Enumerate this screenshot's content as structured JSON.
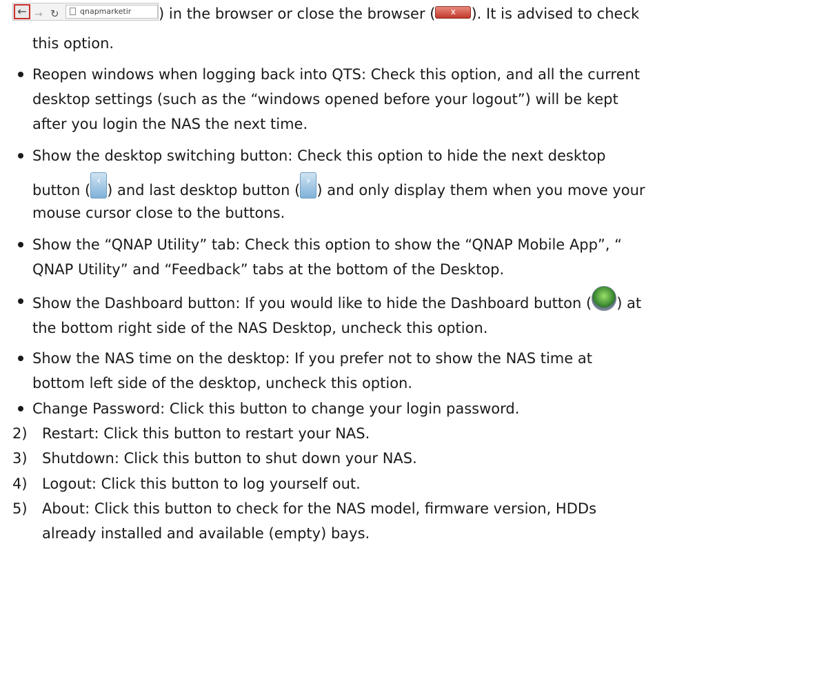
{
  "browser_url_text": "qnapmarketir",
  "close_button_glyph": "x",
  "nav_prev_glyph": "‹",
  "nav_next_glyph": "›",
  "line1_after_strip": ") in the browser or close the browser (",
  "line1_after_close": "). It is advised to check",
  "line2": "this option.",
  "bullets": [
    {
      "lines": [
        "Reopen windows when logging back into QTS: Check this option, and all the current",
        "desktop settings (such as the “windows opened before your logout”) will be kept",
        "after you login the NAS the next time."
      ]
    },
    {
      "line1": "Show the desktop switching button: Check this option to hide the next desktop",
      "line2_a": "button (",
      "line2_b": ") and last desktop button (",
      "line2_c": ") and only display them when you move your",
      "line3": "mouse cursor close to the buttons."
    },
    {
      "lines": [
        "Show the “QNAP Utility” tab: Check this option to show the “QNAP Mobile App”, “",
        "QNAP Utility” and “Feedback” tabs at the bottom of the Desktop."
      ]
    },
    {
      "line1_a": "Show the Dashboard button: If you would like to hide the Dashboard button (",
      "line1_b": ") at",
      "line2": "the bottom right side of the NAS Desktop, uncheck this option."
    },
    {
      "lines": [
        "Show the NAS time on the desktop: If you prefer not to show the NAS time at",
        "bottom left side of the desktop, uncheck this option."
      ]
    },
    {
      "lines": [
        "Change Password: Click this button to change your login password."
      ]
    }
  ],
  "numbered": [
    {
      "num": "2)",
      "text": "Restart: Click this button to restart your NAS."
    },
    {
      "num": "3)",
      "text": "Shutdown: Click this button to shut down your NAS."
    },
    {
      "num": "4)",
      "text": "Logout: Click this button to log yourself out."
    },
    {
      "num": "5)",
      "text": "About: Click this button to check for the NAS model, firmware version, HDDs",
      "cont": "already installed and available (empty) bays."
    }
  ]
}
